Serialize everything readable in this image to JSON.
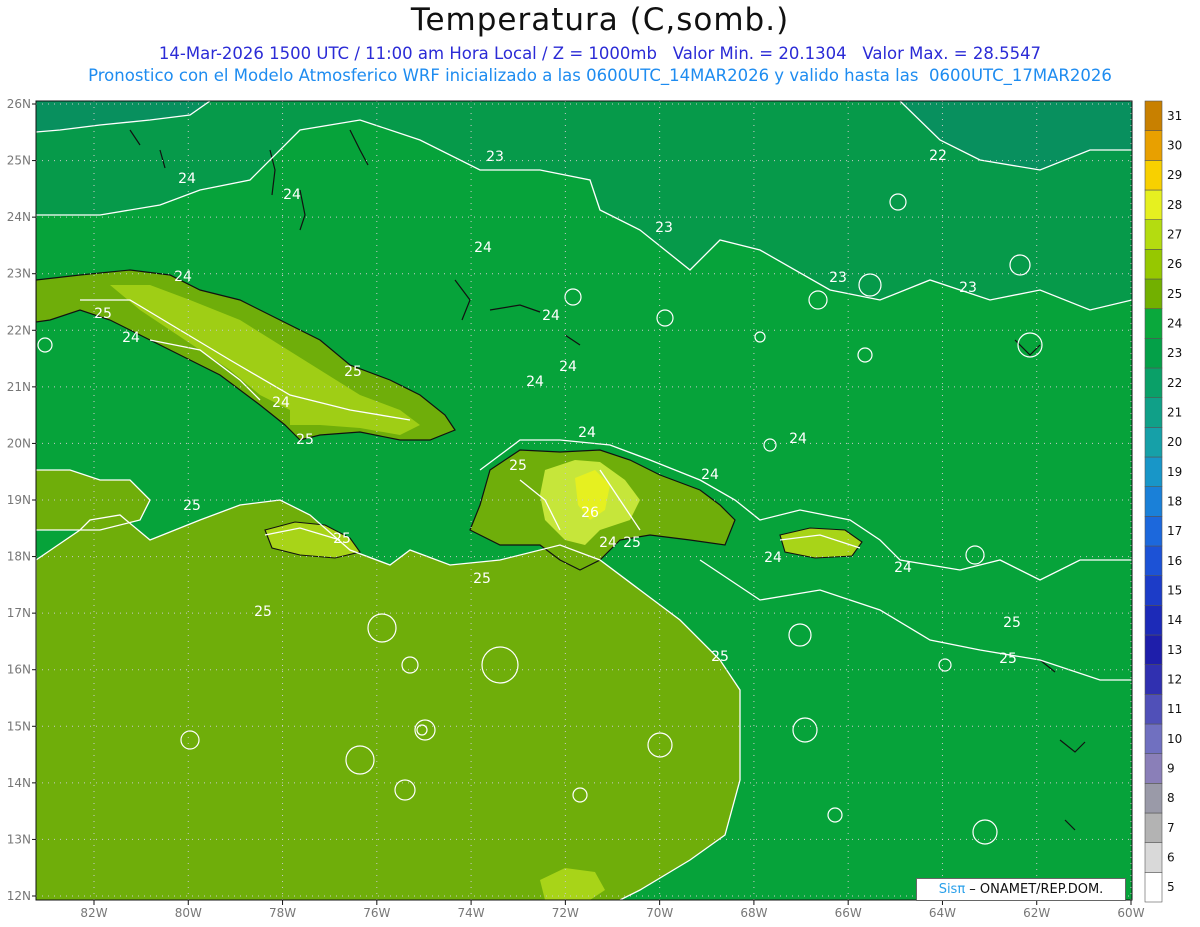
{
  "header": {
    "title": "Temperatura (C,somb.)",
    "line1": "14-Mar-2026 1500 UTC / 11:00 am Hora Local / Z = 1000mb   Valor Min. = 20.1304   Valor Max. = 28.5547",
    "line2": "Pronostico con el Modelo Atmosferico WRF inicializado a las 0600UTC_14MAR2026 y valido hasta las  0600UTC_17MAR2026"
  },
  "axes": {
    "lat_labels": [
      "26N",
      "25N",
      "24N",
      "23N",
      "22N",
      "21N",
      "20N",
      "19N",
      "18N",
      "17N",
      "16N",
      "15N",
      "14N",
      "13N",
      "12N"
    ],
    "lon_labels": [
      "82W",
      "80W",
      "78W",
      "76W",
      "74W",
      "72W",
      "70W",
      "68W",
      "66W",
      "64W",
      "62W",
      "60W"
    ]
  },
  "colorbar": {
    "values": [
      "5",
      "6",
      "7",
      "8",
      "9",
      "10",
      "11",
      "12",
      "13",
      "14",
      "15",
      "16",
      "17",
      "18",
      "19",
      "20",
      "21",
      "22",
      "23",
      "24",
      "25",
      "26",
      "27",
      "28",
      "29",
      "30",
      "31"
    ],
    "colors": [
      "#ffffff",
      "#d9d9d9",
      "#b3b3b3",
      "#9a9aa8",
      "#8a7fb8",
      "#7070c0",
      "#5050b8",
      "#3030b0",
      "#1e1eaa",
      "#1c2ab8",
      "#1c3cc8",
      "#1c52d6",
      "#1c68dc",
      "#1a80d8",
      "#1896c8",
      "#16a0a8",
      "#10a088",
      "#0aa068",
      "#04a048",
      "#0aa83c",
      "#72b000",
      "#96c800",
      "#b4dc10",
      "#e6f020",
      "#f8d000",
      "#e8a000",
      "#c88000"
    ]
  },
  "contours": [
    "22",
    "23",
    "23",
    "23",
    "23",
    "24",
    "24",
    "24",
    "24",
    "24",
    "24",
    "24",
    "24",
    "24",
    "24",
    "24",
    "24",
    "24",
    "24",
    "24",
    "25",
    "25",
    "25",
    "25",
    "25",
    "25",
    "25",
    "25",
    "25",
    "25",
    "25",
    "26",
    "25"
  ],
  "credit": {
    "sis": "Sisπ",
    "rest": " – ONAMET/REP.DOM."
  },
  "colors": {
    "sea": "#06a33a",
    "warm": "#6fae0a",
    "cool": "#0a9a58",
    "hot": "#a8d418",
    "grid": "#c9c9c9"
  }
}
